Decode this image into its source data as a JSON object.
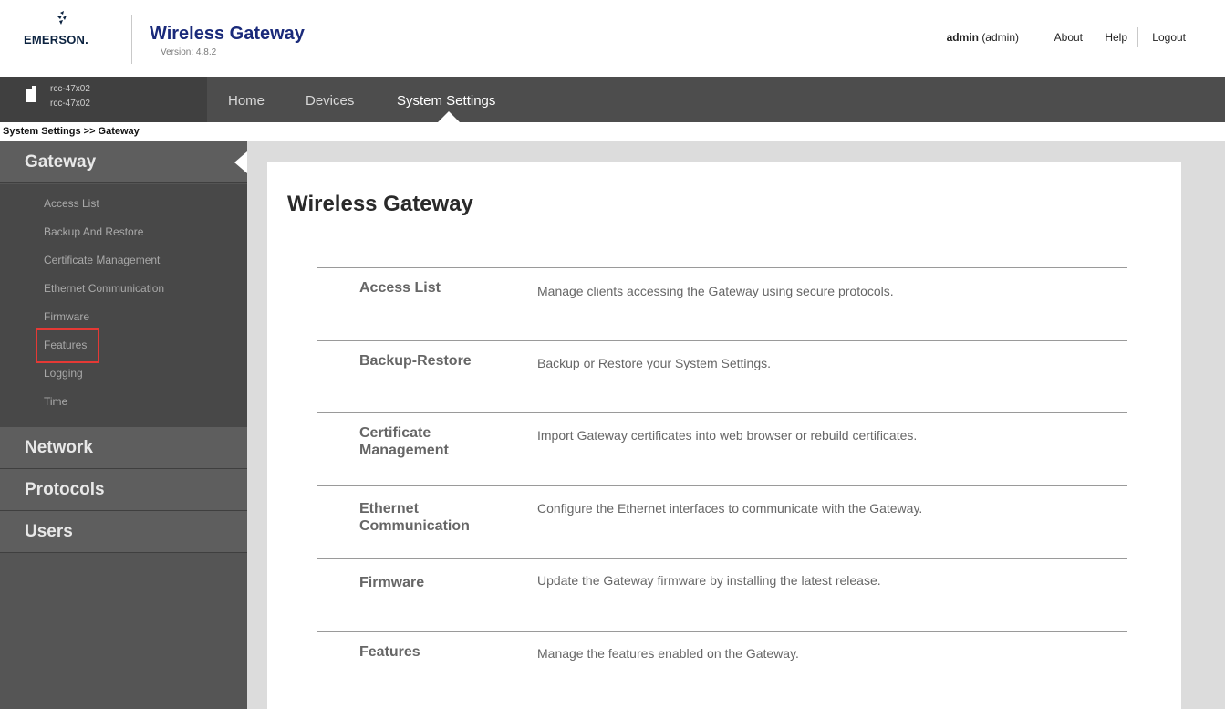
{
  "header": {
    "logo_text": "EMERSON.",
    "title": "Wireless Gateway",
    "version": "Version: 4.8.2",
    "user_bold": "admin",
    "user_role": "(admin)",
    "links": [
      "About",
      "Help",
      "Logout"
    ]
  },
  "device": {
    "line1": "rcc-47x02",
    "line2": "rcc-47x02"
  },
  "nav": {
    "items": [
      "Home",
      "Devices",
      "System Settings"
    ],
    "active": "System Settings"
  },
  "breadcrumb": "System Settings >> Gateway",
  "sidebar": {
    "sections": [
      "Gateway",
      "Network",
      "Protocols",
      "Users"
    ],
    "gateway_items": [
      "Access List",
      "Backup And Restore",
      "Certificate Management",
      "Ethernet Communication",
      "Firmware",
      "Features",
      "Logging",
      "Time"
    ],
    "highlighted_item": "Features"
  },
  "main": {
    "title": "Wireless Gateway",
    "rows": [
      {
        "title": "Access List",
        "desc": "Manage clients accessing the Gateway using secure protocols."
      },
      {
        "title": "Backup-Restore",
        "desc": "Backup or Restore your System Settings."
      },
      {
        "title": "Certificate Management",
        "desc": "Import Gateway certificates into web browser or rebuild certificates."
      },
      {
        "title": "Ethernet Communication",
        "desc": "Configure the Ethernet interfaces to communicate with the Gateway."
      },
      {
        "title": "Firmware",
        "desc": "Update the Gateway firmware by installing the latest release."
      },
      {
        "title": "Features",
        "desc": "Manage the features enabled on the Gateway."
      }
    ]
  },
  "colors": {
    "brand_title": "#1a2a7a",
    "nav_bg": "#4d4d4d",
    "sidebar_bg": "#555555",
    "highlight": "#e53935"
  }
}
